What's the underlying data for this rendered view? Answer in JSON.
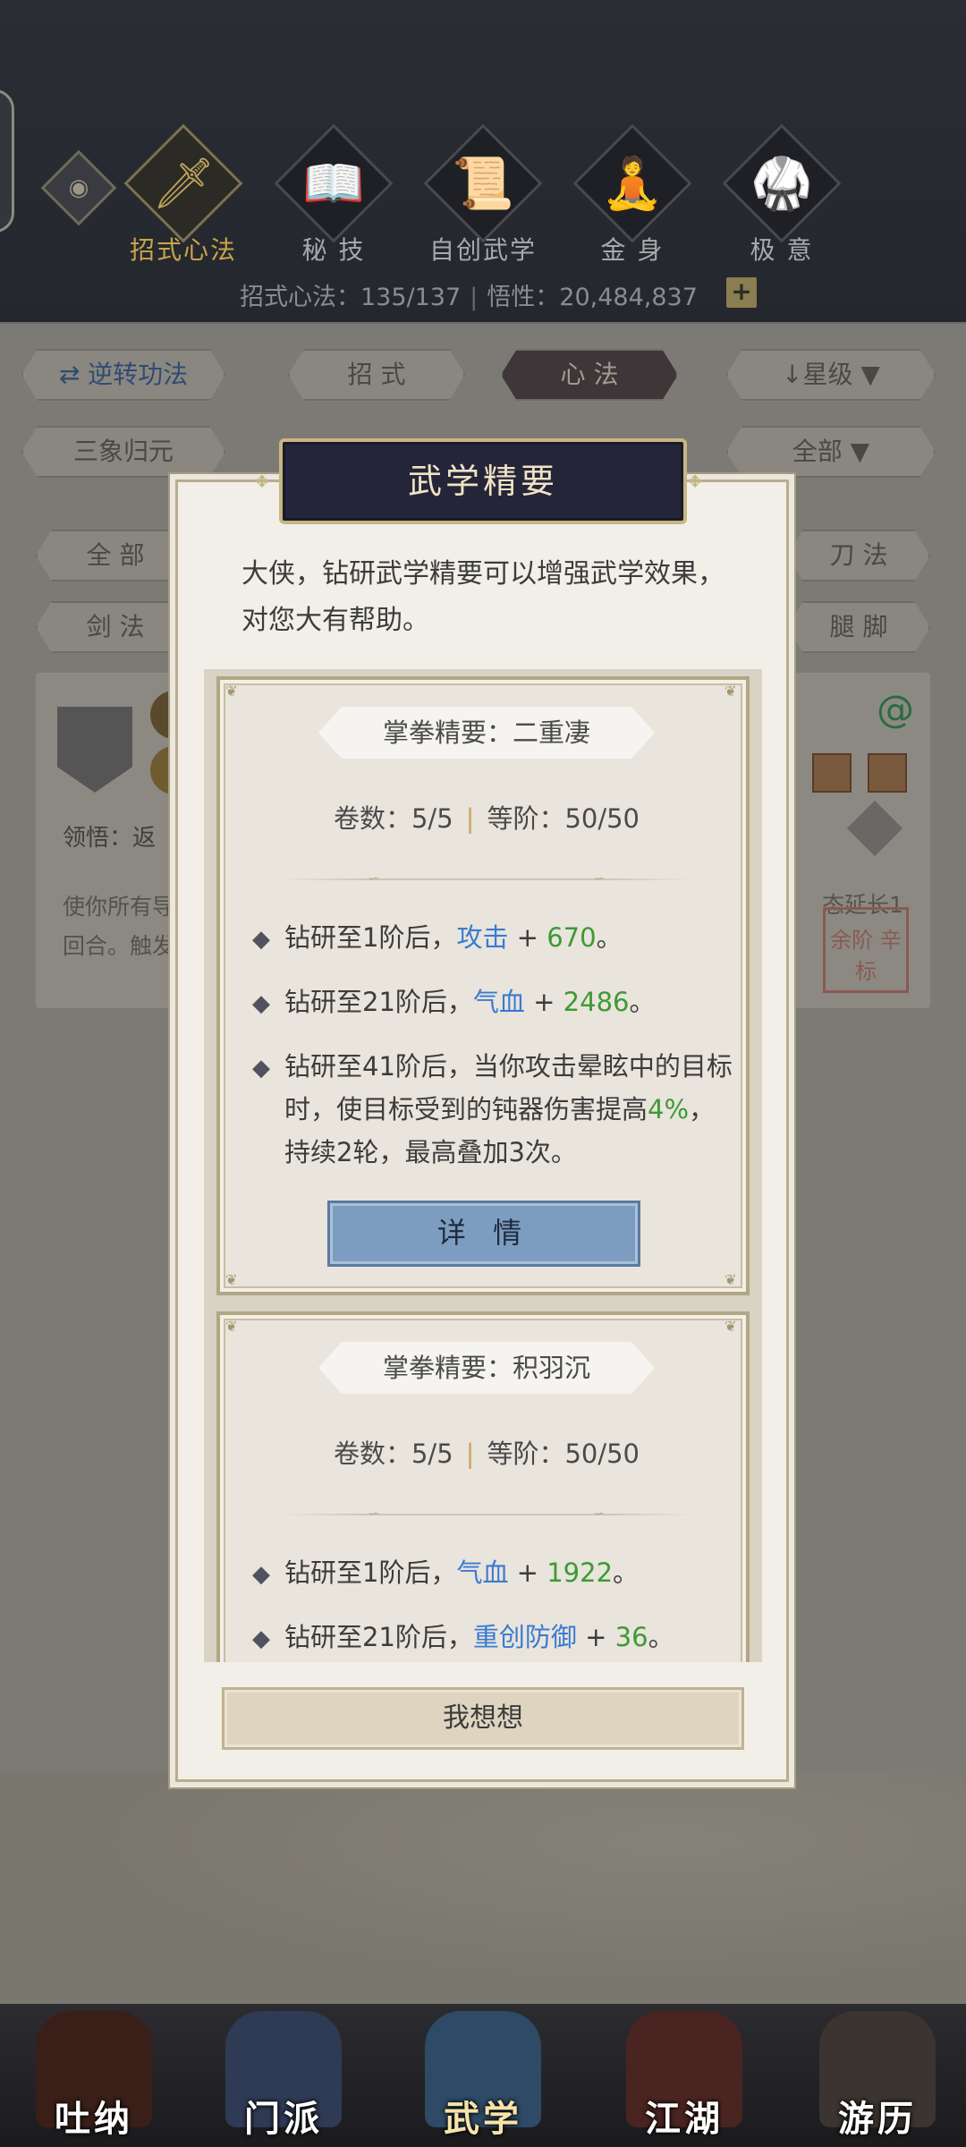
{
  "header": {
    "tabs": [
      {
        "label": "招式心法",
        "glyph": "🗡",
        "icon": "sword-icon",
        "active": true
      },
      {
        "label": "秘 技",
        "glyph": "📖",
        "icon": "book-icon",
        "active": false
      },
      {
        "label": "自创武学",
        "glyph": "📜",
        "icon": "scroll-icon",
        "active": false
      },
      {
        "label": "金 身",
        "glyph": "🧘",
        "icon": "meditation-icon",
        "active": false
      },
      {
        "label": "极 意",
        "glyph": "🥋",
        "icon": "martial-pose-icon",
        "active": false
      }
    ],
    "stats_left": "招式心法：135/137",
    "stats_sep": "|",
    "stats_right": "悟性：20,484,837",
    "plus": "+"
  },
  "filters": {
    "reverse_btn": "⇄  逆转功法",
    "tab_zhaoshi": "招 式",
    "tab_xinfa": "心 法",
    "sort": "↓星级  ▼",
    "sanxiang": "三象归元",
    "all_dropdown": "全部  ▼",
    "cat_all": "全 部",
    "cat_sword": "剑 法",
    "cat_blade": "刀 法",
    "cat_leg": "腿 脚"
  },
  "bg_card": {
    "lingwu": "领悟：返",
    "desc_line1": "使你所有导",
    "desc_line2": "回合。触发",
    "desc_right": "态延长1",
    "seal_text": "余阶 辛标",
    "spiral": "@"
  },
  "modal": {
    "title": "武学精要",
    "intro": "大侠，钻研武学精要可以增强武学效果，对您大有帮助。",
    "cards": [
      {
        "name": "掌拳精要：二重凄",
        "volumes": "卷数：5/5",
        "sep": "|",
        "grade": "等阶：50/50",
        "bullets": [
          {
            "pre": "钻研至1阶后，",
            "attr": "攻击",
            "mid": " + ",
            "num": "670",
            "post": "。"
          },
          {
            "pre": "钻研至21阶后，",
            "attr": "气血",
            "mid": " + ",
            "num": "2486",
            "post": "。"
          },
          {
            "pre": "钻研至41阶后，当你攻击晕眩中的目标时，使目标受到的钝器伤害提高",
            "attr": "",
            "mid": "",
            "num": "4%",
            "post": "，持续2轮，最高叠加3次。"
          }
        ],
        "detail_btn": "详 情"
      },
      {
        "name": "掌拳精要：积羽沉",
        "volumes": "卷数：5/5",
        "sep": "|",
        "grade": "等阶：50/50",
        "bullets": [
          {
            "pre": "钻研至1阶后，",
            "attr": "气血",
            "mid": " + ",
            "num": "1922",
            "post": "。"
          },
          {
            "pre": "钻研至21阶后，",
            "attr": "重创防御",
            "mid": " + ",
            "num": "36",
            "post": "。"
          }
        ]
      }
    ],
    "think_btn": "我想想"
  },
  "bottom_nav": [
    {
      "label": "吐纳",
      "active": false
    },
    {
      "label": "门派",
      "active": false
    },
    {
      "label": "武学",
      "active": true
    },
    {
      "label": "江湖",
      "active": false
    },
    {
      "label": "游历",
      "active": false
    }
  ]
}
